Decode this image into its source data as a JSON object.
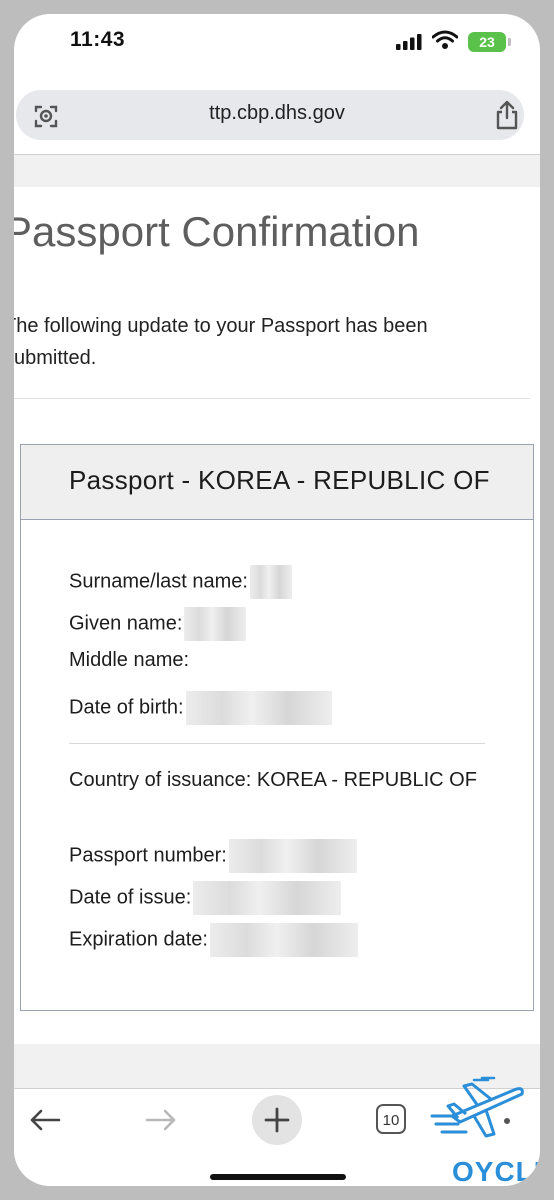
{
  "status_bar": {
    "time": "11:43",
    "battery": "23"
  },
  "browser": {
    "url": "ttp.cbp.dhs.gov",
    "tab_count": "10"
  },
  "page": {
    "title": "Passport Confirmation",
    "intro": "The following update to your Passport has been submitted."
  },
  "card": {
    "title": "Passport - KOREA - REPUBLIC OF",
    "fields_personal": [
      {
        "label": "Surname/last name:",
        "value": ""
      },
      {
        "label": "Given name:",
        "value": ""
      },
      {
        "label": "Middle name:",
        "value": ""
      },
      {
        "label": "Date of birth:",
        "value": ""
      }
    ],
    "fields_passport": [
      {
        "label": "Country of issuance:",
        "value": "KOREA - REPUBLIC OF"
      },
      {
        "label": "Passport number:",
        "value": ""
      },
      {
        "label": "Date of issue:",
        "value": ""
      },
      {
        "label": "Expiration date:",
        "value": ""
      }
    ]
  },
  "watermark": {
    "text": "OYCLE",
    "color": "#2a8ed8"
  }
}
